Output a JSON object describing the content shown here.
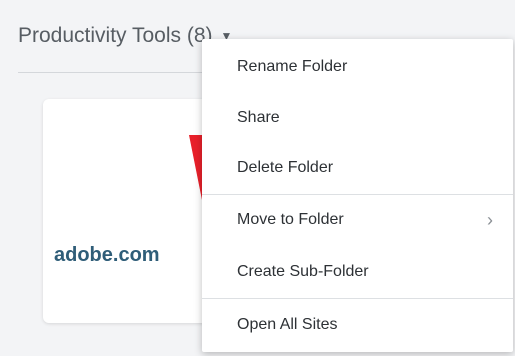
{
  "folder": {
    "title": "Productivity Tools (8)",
    "caret": "▼"
  },
  "card": {
    "site_name": "adobe.com",
    "logo_color": "#e8202a"
  },
  "menu": {
    "items": [
      {
        "label": "Rename Folder"
      },
      {
        "label": "Share"
      },
      {
        "label": "Delete Folder"
      },
      {
        "label": "Move to Folder",
        "submenu": true,
        "chevron": "›"
      },
      {
        "label": "Create Sub-Folder"
      },
      {
        "label": "Open All Sites"
      }
    ]
  }
}
